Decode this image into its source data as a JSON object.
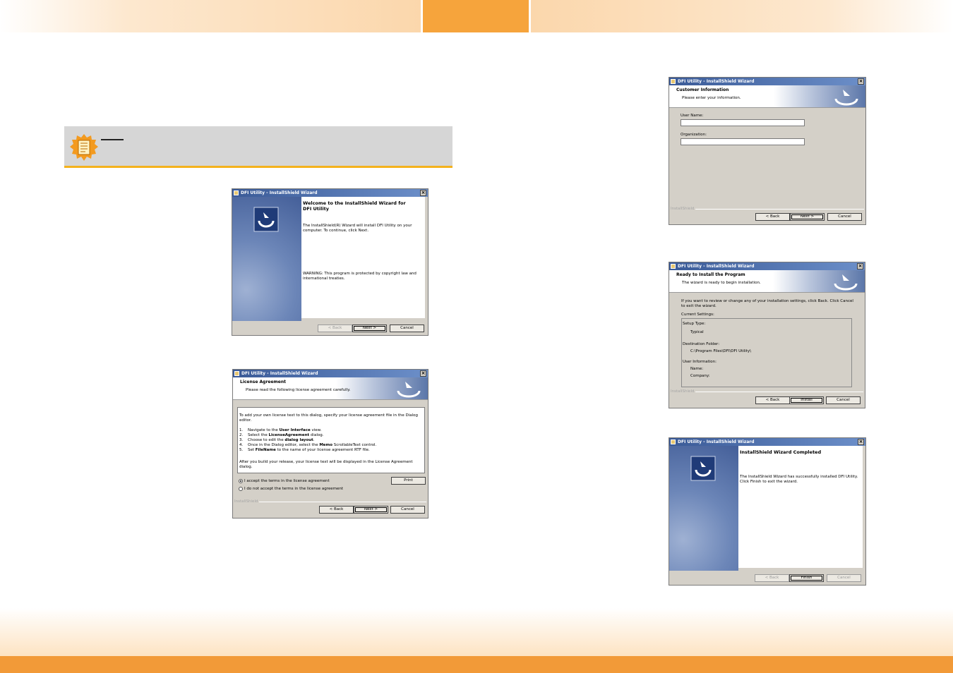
{
  "note": {
    "title": ""
  },
  "wizard_welcome": {
    "title": "DFI Utility - InstallShield Wizard",
    "heading": "Welcome to the InstallShield Wizard for DFI Utility",
    "body": "The InstallShield(R) Wizard will install DFI Utility on your computer. To continue, click Next.",
    "warning": "WARNING: This program is protected by copyright law and international treaties.",
    "buttons": {
      "back": "< Back",
      "next": "Next >",
      "cancel": "Cancel"
    }
  },
  "wizard_license": {
    "title": "DFI Utility - InstallShield Wizard",
    "banner_title": "License Agreement",
    "banner_sub": "Please read the following license agreement carefully.",
    "intro": "To add your own license text to this dialog, specify your license agreement file in the Dialog editor.",
    "steps": [
      {
        "num": "1.",
        "pre": "Navigate to the ",
        "bold": "User Interface",
        "post": " view."
      },
      {
        "num": "2.",
        "pre": "Select the ",
        "bold": "LicenseAgreement",
        "post": " dialog."
      },
      {
        "num": "3.",
        "pre": "Choose to edit the ",
        "bold": "dialog layout",
        "post": "."
      },
      {
        "num": "4.",
        "pre": "Once in the Dialog editor, select the ",
        "bold": "Memo",
        "post": " ScrollableText control."
      },
      {
        "num": "5.",
        "pre": "Set ",
        "bold": "FileName",
        "post": " to the name of your license agreement RTF file."
      }
    ],
    "outro": "After you build your release, your license text will be displayed in the License Agreement dialog.",
    "accept": "I accept the terms in the license agreement",
    "decline": "I do not accept the terms in the license agreement",
    "print": "Print",
    "footer": "InstallShield",
    "buttons": {
      "back": "< Back",
      "next": "Next >",
      "cancel": "Cancel"
    }
  },
  "wizard_customer": {
    "title": "DFI Utility - InstallShield Wizard",
    "banner_title": "Customer Information",
    "banner_sub": "Please enter your information.",
    "user_label": "User Name:",
    "user_value": "",
    "org_label": "Organization:",
    "org_value": "",
    "footer": "InstallShield",
    "buttons": {
      "back": "< Back",
      "next": "Next >",
      "cancel": "Cancel"
    }
  },
  "wizard_ready": {
    "title": "DFI Utility - InstallShield Wizard",
    "banner_title": "Ready to Install the Program",
    "banner_sub": "The wizard is ready to begin installation.",
    "intro": "If you want to review or change any of your installation settings, click Back. Click Cancel to exit the wizard.",
    "current_settings": "Current Settings:",
    "setup_type_label": "Setup Type:",
    "setup_type_value": "Typical",
    "dest_label": "Destination Folder:",
    "dest_value": "C:\\Program Files\\DFI\\DFI Utility\\",
    "user_info_label": "User Information:",
    "name_label": "Name:",
    "company_label": "Company:",
    "footer": "InstallShield",
    "buttons": {
      "back": "< Back",
      "install": "Install",
      "cancel": "Cancel"
    }
  },
  "wizard_complete": {
    "title": "DFI Utility - InstallShield Wizard",
    "heading": "InstallShield Wizard Completed",
    "body": "The InstallShield Wizard has successfully installed DFI Utility. Click Finish to exit the wizard.",
    "buttons": {
      "back": "< Back",
      "finish": "Finish",
      "cancel": "Cancel"
    }
  },
  "colors": {
    "accent_orange": "#f6a43c",
    "note_bar": "#f4b21d",
    "title_blue": "#3a5a97"
  }
}
